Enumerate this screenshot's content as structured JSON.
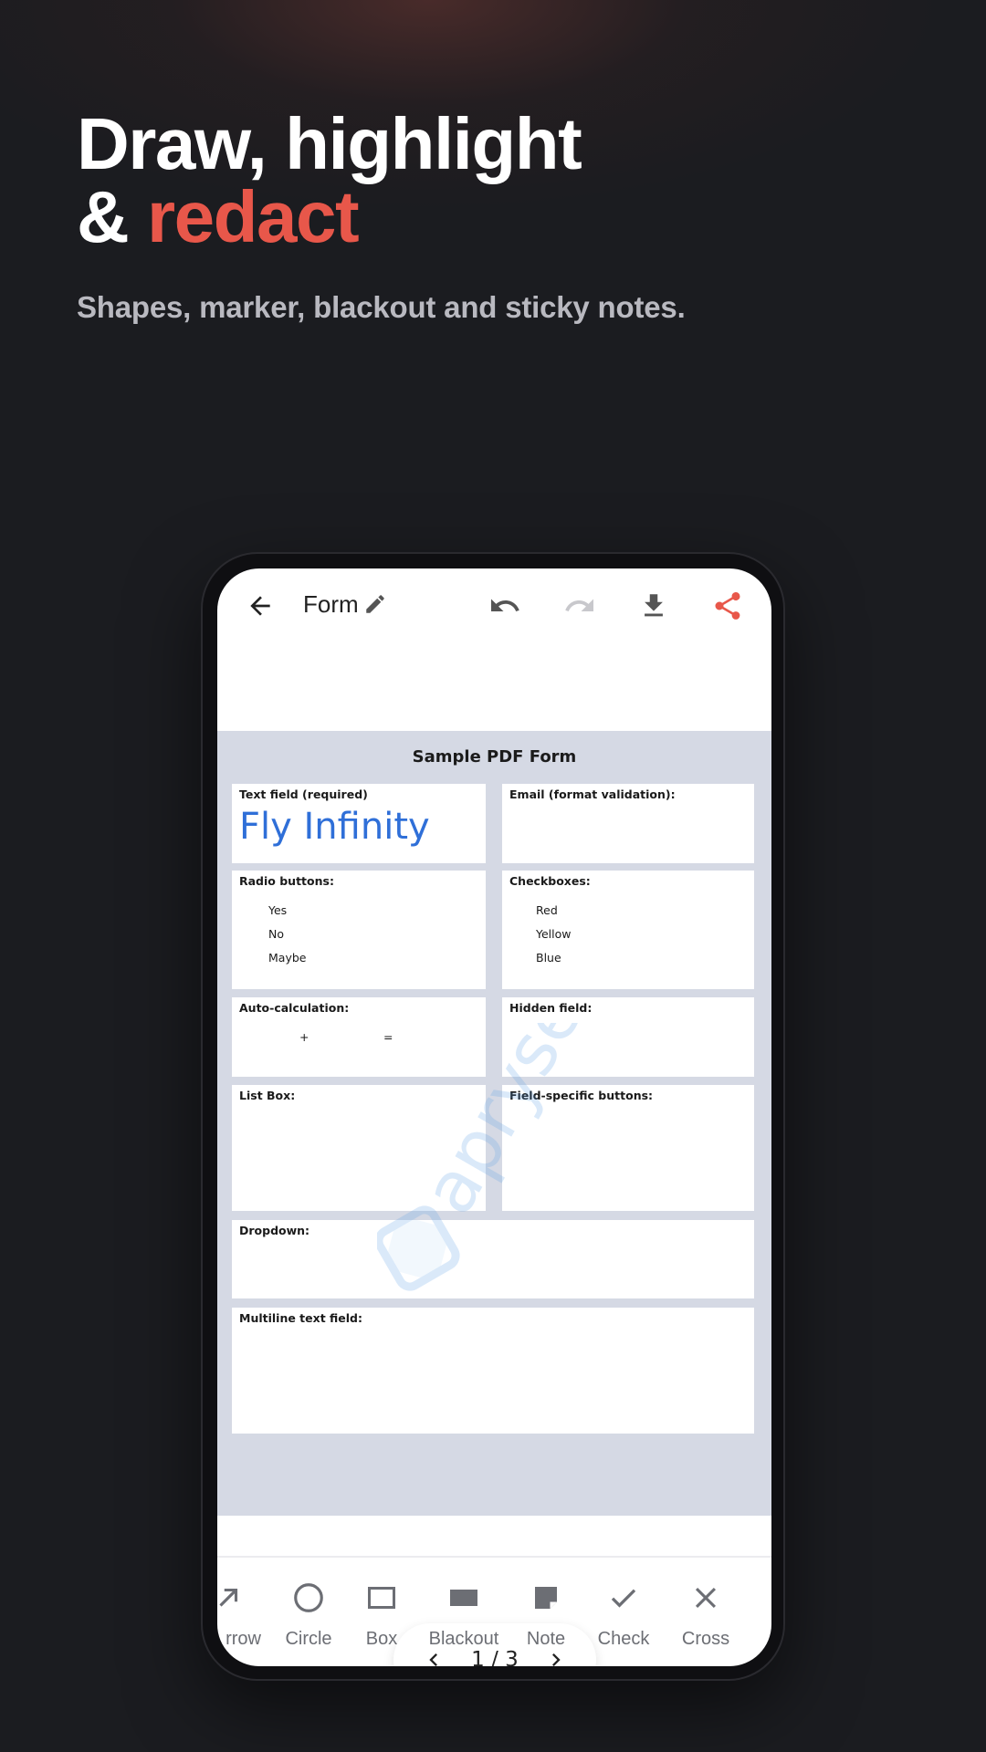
{
  "hero": {
    "title_line1": "Draw, highlight",
    "title_amp": "& ",
    "title_accent": "redact",
    "subtitle": "Shapes, marker, blackout and sticky notes."
  },
  "colors": {
    "accent": "#e8574a",
    "background": "#1b1c20",
    "link_blue": "#2f6fd8"
  },
  "app": {
    "doc_name": "Form",
    "icons": [
      "back-arrow-icon",
      "edit-pencil-icon",
      "undo-icon",
      "redo-icon",
      "download-icon",
      "share-icon"
    ]
  },
  "document": {
    "title": "Sample PDF Form",
    "fields": {
      "text_field_label": "Text field (required)",
      "text_field_value": "Fly Infinity",
      "email_label": "Email (format validation):",
      "radio_label": "Radio buttons:",
      "radio_options": [
        "Yes",
        "No",
        "Maybe"
      ],
      "checkbox_label": "Checkboxes:",
      "checkbox_options": [
        "Red",
        "Yellow",
        "Blue"
      ],
      "auto_calc_label": "Auto-calculation:",
      "plus": "+",
      "equals": "=",
      "hidden_label": "Hidden field:",
      "list_box_label": "List Box:",
      "field_buttons_label": "Field-specific buttons:",
      "dropdown_label": "Dropdown:",
      "multiline_label": "Multiline text field:"
    },
    "watermark": "apryse"
  },
  "pager": {
    "text": "1 / 3"
  },
  "toolbar": {
    "tools": [
      {
        "label": "rrow",
        "icon": "arrow-icon"
      },
      {
        "label": "Circle",
        "icon": "circle-icon"
      },
      {
        "label": "Box",
        "icon": "box-icon"
      },
      {
        "label": "Blackout",
        "icon": "blackout-icon"
      },
      {
        "label": "Note",
        "icon": "note-icon"
      },
      {
        "label": "Check",
        "icon": "check-icon"
      },
      {
        "label": "Cross",
        "icon": "cross-icon"
      }
    ]
  }
}
